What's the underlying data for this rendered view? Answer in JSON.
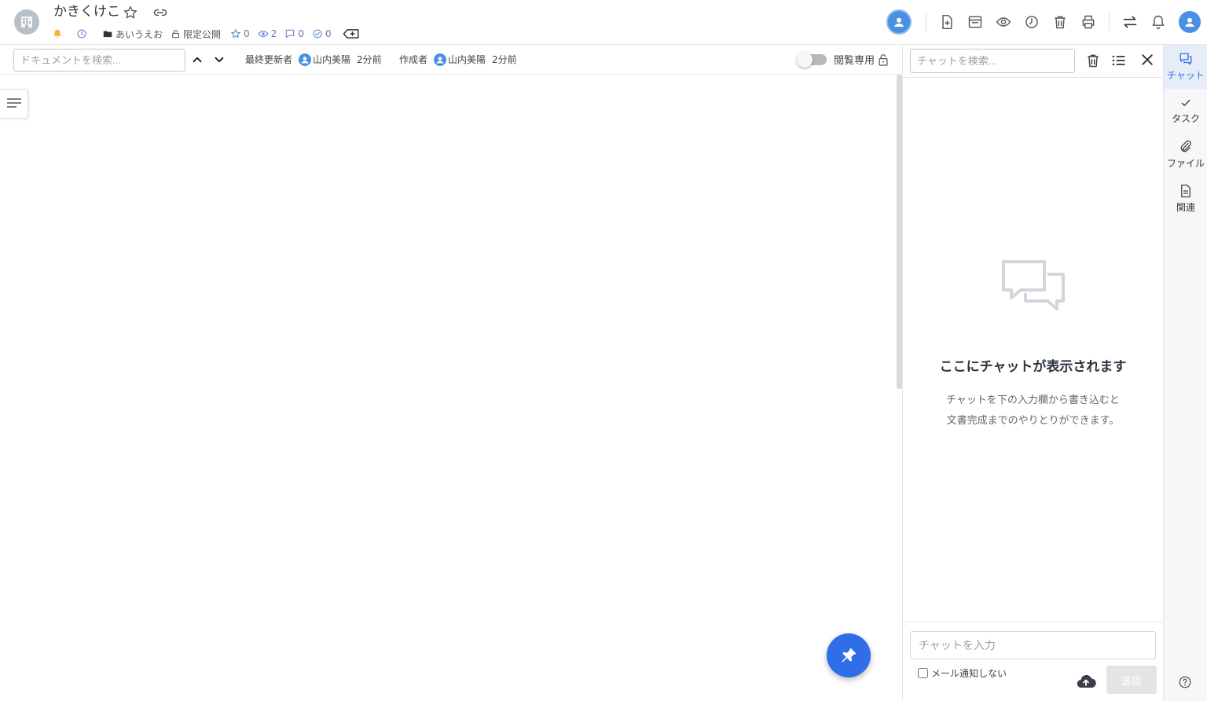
{
  "header": {
    "title": "かきくけこ",
    "meta": {
      "folder": "あいうえお",
      "visibility": "限定公開",
      "stars": "0",
      "views": "2",
      "comments": "0",
      "checks": "0"
    }
  },
  "toolbar": {
    "search_placeholder": "ドキュメントを検索...",
    "updater_label": "最終更新者",
    "updater_name": "山内美陽",
    "updater_time": "2分前",
    "creator_label": "作成者",
    "creator_name": "山内美陽",
    "creator_time": "2分前",
    "readonly_label": "閲覧専用",
    "readonly_on": false
  },
  "chat": {
    "search_placeholder": "チャットを検索...",
    "empty_title": "ここにチャットが表示されます",
    "empty_line1": "チャットを下の入力欄から書き込むと",
    "empty_line2": "文書完成までのやりとりができます。",
    "input_placeholder": "チャットを入力",
    "no_mail_label": "メール通知しない",
    "send_label": "送信"
  },
  "rail": {
    "items": [
      {
        "label": "チャット",
        "icon": "chat-icon",
        "active": true
      },
      {
        "label": "タスク",
        "icon": "check-icon",
        "active": false
      },
      {
        "label": "ファイル",
        "icon": "paperclip-icon",
        "active": false
      },
      {
        "label": "関連",
        "icon": "document-icon",
        "active": false
      }
    ]
  },
  "colors": {
    "accent": "#2f6ee8",
    "avatar": "#4a90e2",
    "bell": "#f2b632"
  }
}
